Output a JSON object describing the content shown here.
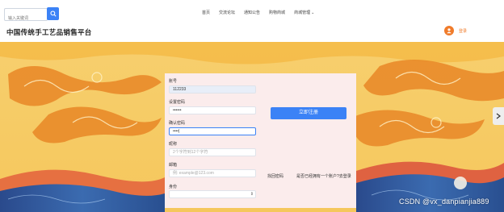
{
  "header": {
    "search_placeholder": "输入关键词",
    "nav": [
      "首页",
      "交流论坛",
      "通知公告",
      "购物商城",
      "商城管理"
    ],
    "site_title": "中国传统手工艺品销售平台",
    "login_label": "登录"
  },
  "form": {
    "account_label": "账号",
    "account_value": "112233",
    "password_label": "设置密码",
    "password_value": "••••••",
    "confirm_label": "确认密码",
    "confirm_value": "••••|",
    "nickname_label": "昵称",
    "nickname_placeholder": "2个字符到12个字符",
    "email_label": "邮箱",
    "email_placeholder": "例: example@123.com",
    "role_label": "身份",
    "role_value": "",
    "submit_label": "立即注册",
    "forgot_link": "找回密码",
    "login_link": "是否已经拥有一个账户?去登录"
  },
  "watermark": "CSDN @vx_danpianjia889",
  "colors": {
    "accent": "#3b82f6",
    "login_orange": "#f07b2a",
    "panel_bg": "#fbecec"
  }
}
